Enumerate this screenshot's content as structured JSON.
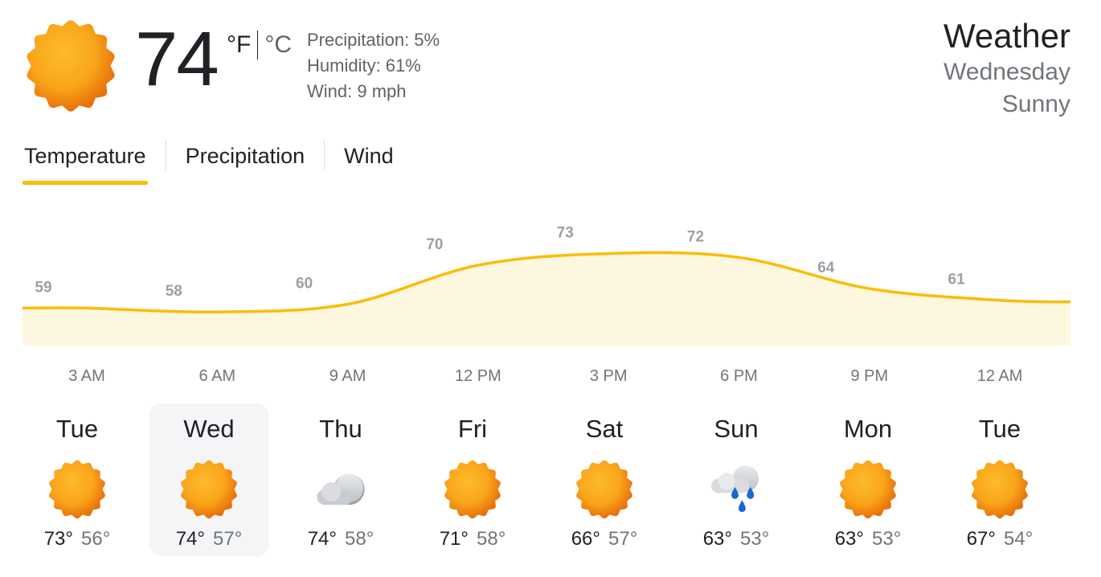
{
  "current": {
    "icon": "sun-icon",
    "temperature": "74",
    "unit_f": "°F",
    "unit_c": "°C",
    "precipitation": "Precipitation: 5%",
    "humidity": "Humidity: 61%",
    "wind": "Wind: 9 mph"
  },
  "header": {
    "title": "Weather",
    "day": "Wednesday",
    "condition": "Sunny"
  },
  "tabs": [
    {
      "label": "Temperature",
      "active": true
    },
    {
      "label": "Precipitation",
      "active": false
    },
    {
      "label": "Wind",
      "active": false
    }
  ],
  "chart_data": {
    "type": "area",
    "x": [
      "3 AM",
      "6 AM",
      "9 AM",
      "12 PM",
      "3 PM",
      "6 PM",
      "9 PM",
      "12 AM"
    ],
    "values": [
      59,
      58,
      60,
      70,
      73,
      72,
      64,
      61
    ],
    "colors": {
      "line": "#fbbc04",
      "fill": "#fef7e0"
    }
  },
  "forecast": [
    {
      "day": "Tue",
      "icon": "sun-icon",
      "high": "73°",
      "low": "56°",
      "selected": false
    },
    {
      "day": "Wed",
      "icon": "sun-icon",
      "high": "74°",
      "low": "57°",
      "selected": true
    },
    {
      "day": "Thu",
      "icon": "cloud-icon",
      "high": "74°",
      "low": "58°",
      "selected": false
    },
    {
      "day": "Fri",
      "icon": "sun-icon",
      "high": "71°",
      "low": "58°",
      "selected": false
    },
    {
      "day": "Sat",
      "icon": "sun-icon",
      "high": "66°",
      "low": "57°",
      "selected": false
    },
    {
      "day": "Sun",
      "icon": "rain-cloud-icon",
      "high": "63°",
      "low": "53°",
      "selected": false
    },
    {
      "day": "Mon",
      "icon": "sun-icon",
      "high": "63°",
      "low": "53°",
      "selected": false
    },
    {
      "day": "Tue",
      "icon": "sun-icon",
      "high": "67°",
      "low": "54°",
      "selected": false
    }
  ]
}
